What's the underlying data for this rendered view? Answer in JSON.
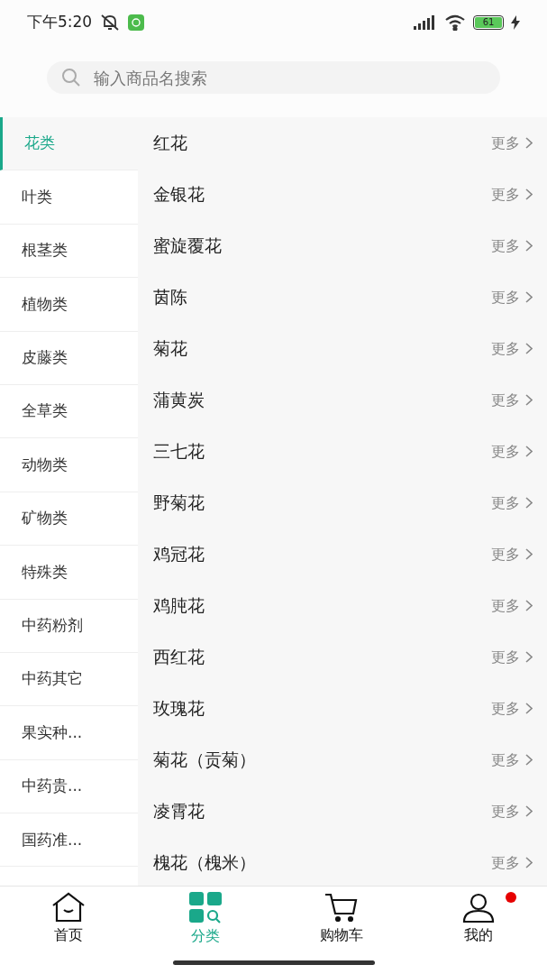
{
  "status_bar": {
    "time": "下午5:20",
    "battery": "61"
  },
  "search": {
    "placeholder": "输入商品名搜索"
  },
  "categories": [
    {
      "label": "花类",
      "selected": true
    },
    {
      "label": "叶类",
      "selected": false
    },
    {
      "label": "根茎类",
      "selected": false
    },
    {
      "label": "植物类",
      "selected": false
    },
    {
      "label": "皮藤类",
      "selected": false
    },
    {
      "label": "全草类",
      "selected": false
    },
    {
      "label": "动物类",
      "selected": false
    },
    {
      "label": "矿物类",
      "selected": false
    },
    {
      "label": "特殊类",
      "selected": false
    },
    {
      "label": "中药粉剂",
      "selected": false
    },
    {
      "label": "中药其它",
      "selected": false
    },
    {
      "label": "果实种...",
      "selected": false
    },
    {
      "label": "中药贵...",
      "selected": false
    },
    {
      "label": "国药准...",
      "selected": false
    }
  ],
  "items": [
    {
      "name": "红花",
      "more": "更多"
    },
    {
      "name": "金银花",
      "more": "更多"
    },
    {
      "name": "蜜旋覆花",
      "more": "更多"
    },
    {
      "name": "茵陈",
      "more": "更多"
    },
    {
      "name": "菊花",
      "more": "更多"
    },
    {
      "name": "蒲黄炭",
      "more": "更多"
    },
    {
      "name": "三七花",
      "more": "更多"
    },
    {
      "name": "野菊花",
      "more": "更多"
    },
    {
      "name": "鸡冠花",
      "more": "更多"
    },
    {
      "name": "鸡肫花",
      "more": "更多"
    },
    {
      "name": "西红花",
      "more": "更多"
    },
    {
      "name": "玫瑰花",
      "more": "更多"
    },
    {
      "name": "菊花（贡菊）",
      "more": "更多"
    },
    {
      "name": "凌霄花",
      "more": "更多"
    },
    {
      "name": "槐花（槐米）",
      "more": "更多"
    }
  ],
  "tab_bar": [
    {
      "kind": "home",
      "label": "首页",
      "selected": false,
      "badge": false
    },
    {
      "kind": "category",
      "label": "分类",
      "selected": true,
      "badge": false
    },
    {
      "kind": "cart",
      "label": "购物车",
      "selected": false,
      "badge": false
    },
    {
      "kind": "profile",
      "label": "我的",
      "selected": false,
      "badge": true
    }
  ]
}
